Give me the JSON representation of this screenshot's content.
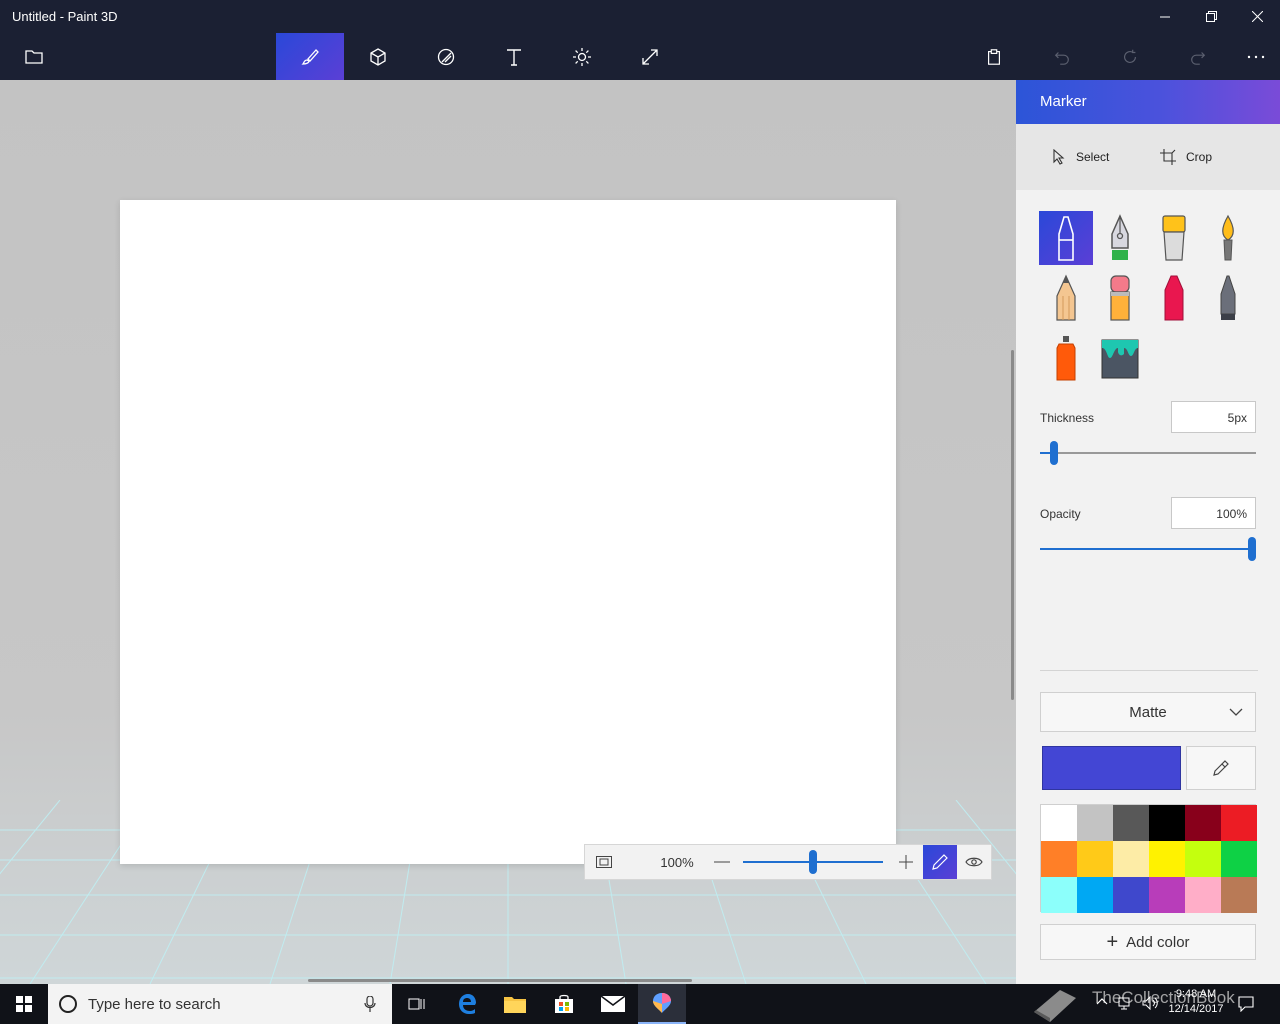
{
  "window": {
    "title": "Untitled - Paint 3D"
  },
  "panel": {
    "title": "Marker",
    "select_label": "Select",
    "crop_label": "Crop",
    "thickness_label": "Thickness",
    "thickness_value": "5px",
    "thickness_level": 0.05,
    "opacity_label": "Opacity",
    "opacity_value": "100%",
    "opacity_level": 1.0,
    "finish": "Matte",
    "current_color": "#4346d4",
    "add_color_label": "Add color",
    "palette": [
      "#ffffff",
      "#c3c3c3",
      "#585858",
      "#000000",
      "#88001b",
      "#ec1c24",
      "#ff7f27",
      "#ffca18",
      "#fdeca6",
      "#fff200",
      "#c4ff0e",
      "#0ed145",
      "#8cfffb",
      "#00a8f3",
      "#3f48cc",
      "#b83dba",
      "#ffaec8",
      "#b97a56"
    ],
    "brushes": [
      "marker",
      "calligraphy-pen",
      "oil-brush",
      "watercolor",
      "pencil",
      "eraser",
      "crayon",
      "pixel-pen",
      "spray-can",
      "fill"
    ]
  },
  "zoom": {
    "value": "100%",
    "level": 0.5
  },
  "taskbar": {
    "search_placeholder": "Type here to search",
    "time": "9:48 AM",
    "date": "12/14/2017",
    "watermark": "TheCollectionBook"
  }
}
